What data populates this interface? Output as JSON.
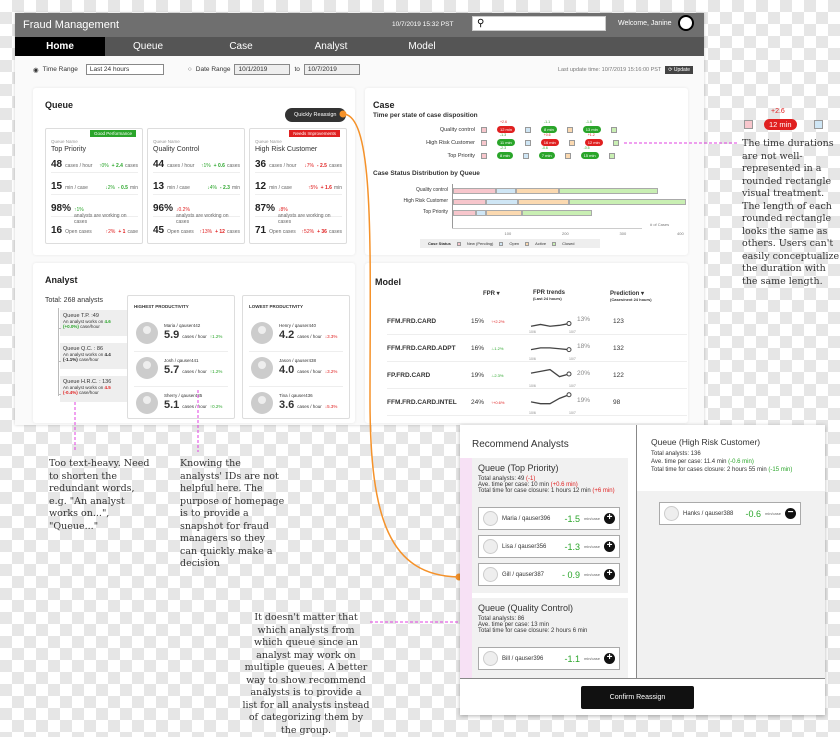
{
  "header": {
    "title": "Fraud Management",
    "datetime": "10/7/2019 15:32 PST",
    "search_placeholder": "",
    "welcome": "Welcome, Janine"
  },
  "nav": [
    {
      "label": "Home",
      "active": true
    },
    {
      "label": "Queue"
    },
    {
      "label": "Case"
    },
    {
      "label": "Analyst"
    },
    {
      "label": "Model"
    }
  ],
  "filters": {
    "time_range_label": "Time Range",
    "time_range_value": "Last 24 hours",
    "date_range_label": "Date Range",
    "date_from": "10/1/2019",
    "to_label": "to",
    "date_to": "10/7/2019",
    "last_update": "Last update time: 10/7/2019 15:16:00 PST",
    "update_button": "⟳ Update"
  },
  "queue": {
    "title": "Queue",
    "reassign_button": "Quickly Reassign",
    "name_label": "Queue Name",
    "cards": [
      {
        "name": "Top Priority",
        "badge": "Good Performance",
        "badge_color": "#2aa52a",
        "rows": [
          {
            "value": "48",
            "unit": "cases / hour",
            "pct": "↑0%",
            "delta": "+ 2.4",
            "dunit": "cases",
            "pc": "g",
            "dc": "g"
          },
          {
            "value": "15",
            "unit": "min / case",
            "pct": "↓2%",
            "delta": "- 0.5",
            "dunit": "min",
            "pc": "g",
            "dc": "g"
          },
          {
            "value": "98%",
            "unit": "analysts are working on cases",
            "pct": "↑1%",
            "delta": "",
            "dunit": "",
            "pc": "g",
            "dc": "g"
          },
          {
            "value": "16",
            "unit": "Open cases",
            "pct": "↑2%",
            "delta": "+ 1",
            "dunit": "case",
            "pc": "r",
            "dc": "r"
          }
        ]
      },
      {
        "name": "Quality Control",
        "badge": "",
        "rows": [
          {
            "value": "44",
            "unit": "cases / hour",
            "pct": "↑1%",
            "delta": "+ 0.6",
            "dunit": "cases",
            "pc": "g",
            "dc": "g"
          },
          {
            "value": "13",
            "unit": "min / case",
            "pct": "↓4%",
            "delta": "- 2.3",
            "dunit": "min",
            "pc": "g",
            "dc": "g"
          },
          {
            "value": "96%",
            "unit": "analysts are working on cases",
            "pct": "↓0.2%",
            "delta": "",
            "dunit": "",
            "pc": "r",
            "dc": "r"
          },
          {
            "value": "45",
            "unit": "Open cases",
            "pct": "↑13%",
            "delta": "+ 12",
            "dunit": "cases",
            "pc": "r",
            "dc": "r"
          }
        ]
      },
      {
        "name": "High Risk Customer",
        "badge": "Needs Improvements",
        "badge_color": "#e02020",
        "rows": [
          {
            "value": "36",
            "unit": "cases / hour",
            "pct": "↓7%",
            "delta": "- 2.5",
            "dunit": "cases",
            "pc": "r",
            "dc": "r"
          },
          {
            "value": "12",
            "unit": "min / case",
            "pct": "↑5%",
            "delta": "+ 1.6",
            "dunit": "min",
            "pc": "r",
            "dc": "r"
          },
          {
            "value": "87%",
            "unit": "analysts are working on cases",
            "pct": "↓8%",
            "delta": "",
            "dunit": "",
            "pc": "r",
            "dc": "r"
          },
          {
            "value": "71",
            "unit": "Open cases",
            "pct": "↑52%",
            "delta": "+ 36",
            "dunit": "cases",
            "pc": "r",
            "dc": "r"
          }
        ]
      }
    ]
  },
  "case": {
    "title": "Case",
    "subtitle1": "Time per state of case disposition",
    "subtitle2": "Case Status Distribution by Queue",
    "time_rows": [
      {
        "label": "Quality control",
        "pills": [
          {
            "text": "12 min",
            "delta": "+2.6",
            "color": "#e02020"
          },
          {
            "text": "8 min",
            "delta": "-1.1",
            "color": "#2aa52a"
          },
          {
            "text": "13 min",
            "delta": "-1.8",
            "color": "#2aa52a"
          }
        ]
      },
      {
        "label": "High Risk Customer",
        "pills": [
          {
            "text": "11 min",
            "delta": "-1.3",
            "color": "#2aa52a"
          },
          {
            "text": "16 min",
            "delta": "+0.6",
            "color": "#e02020"
          },
          {
            "text": "12 min",
            "delta": "+1.2",
            "color": "#e02020"
          }
        ]
      },
      {
        "label": "Top Priority",
        "pills": [
          {
            "text": "8 min",
            "delta": "-2.3",
            "color": "#2aa52a"
          },
          {
            "text": "7 min",
            "delta": "-0.6",
            "color": "#2aa52a"
          },
          {
            "text": "15 min",
            "delta": "-0.5",
            "color": "#2aa52a"
          }
        ]
      }
    ],
    "chart_data": {
      "type": "bar",
      "stacked": true,
      "orientation": "horizontal",
      "categories": [
        "Quality control",
        "High Risk Customer",
        "Top Priority"
      ],
      "series": [
        {
          "name": "New (Pending)",
          "color": "#f7c6cc",
          "values": [
            75,
            58,
            40
          ]
        },
        {
          "name": "Open",
          "color": "#cfe6f5",
          "values": [
            35,
            55,
            18
          ]
        },
        {
          "name": "Active",
          "color": "#fbd9b0",
          "values": [
            75,
            88,
            62
          ]
        },
        {
          "name": "Closed",
          "color": "#c9efb3",
          "values": [
            172,
            205,
            122
          ]
        }
      ],
      "xlabel": "# of Cases",
      "xticks": [
        100,
        200,
        300,
        400
      ],
      "xlim": [
        0,
        420
      ],
      "legend_title": "Case Status",
      "legend": "bottom"
    }
  },
  "analyst": {
    "title": "Analyst",
    "total": "Total: 268 analysts",
    "queues": [
      {
        "name": "Queue T.P. :49",
        "desc": "An analyst works on",
        "val": "4.6",
        "chg": "(+0.0%)",
        "unit": "case/hour",
        "c": "g"
      },
      {
        "name": "Queue Q.C. : 86",
        "desc": "An analyst works on",
        "val": "4.4",
        "chg": "(-1.1%)",
        "unit": "case/hour",
        "c": "k"
      },
      {
        "name": "Queue H.R.C. : 136",
        "desc": "An analyst works on",
        "val": "4.5",
        "chg": "(-0.4%)",
        "unit": "case/hour",
        "c": "r"
      }
    ],
    "highest": {
      "title": "HIGHEST PRODUCTIVITY",
      "items": [
        {
          "name": "Maria / qauser442",
          "value": "5.9",
          "unit": "cases / hour",
          "chg": "↑1.2%",
          "c": "g"
        },
        {
          "name": "Josh / qauser441",
          "value": "5.7",
          "unit": "cases / hour",
          "chg": "↑1.2%",
          "c": "g"
        },
        {
          "name": "Sherry / qauser435",
          "value": "5.1",
          "unit": "cases / hour",
          "chg": "↑0.2%",
          "c": "g"
        }
      ]
    },
    "lowest": {
      "title": "LOWEST PRODUCTIVITY",
      "items": [
        {
          "name": "Henry / qauser440",
          "value": "4.2",
          "unit": "cases / hour",
          "chg": "↓3.3%",
          "c": "r"
        },
        {
          "name": "Jason / qauser438",
          "value": "4.0",
          "unit": "cases / hour",
          "chg": "↓3.2%",
          "c": "r"
        },
        {
          "name": "Tina / qauser436",
          "value": "3.6",
          "unit": "cases / hour",
          "chg": "↓5.3%",
          "c": "r"
        }
      ]
    }
  },
  "model": {
    "title": "Model",
    "col_fpr": "FPR",
    "col_trend": "FPR trends",
    "col_trend_sub": "(Last 24 hours)",
    "col_pred": "Prediction",
    "col_pred_sub": "(Cases/next 24 hours)",
    "rows": [
      {
        "name": "FFM.FRD.CARD",
        "fpr": "15%",
        "chg": "↑+2.2%",
        "c": "r",
        "last": "13%",
        "pred": "123",
        "trend": [
          12,
          14,
          12,
          13,
          15
        ]
      },
      {
        "name": "FFM.FRD.CARD.ADPT",
        "fpr": "16%",
        "chg": "↓-1.2%",
        "c": "g",
        "last": "18%",
        "pred": "132",
        "trend": [
          16,
          18,
          18,
          17,
          16
        ]
      },
      {
        "name": "FP.FRD.CARD",
        "fpr": "19%",
        "chg": "↓-2.3%",
        "c": "g",
        "last": "20%",
        "pred": "122",
        "trend": [
          20,
          22,
          24,
          16,
          19
        ]
      },
      {
        "name": "FFM.FRD.CARD.INTEL",
        "fpr": "24%",
        "chg": "↑+0.6%",
        "c": "r",
        "last": "19%",
        "pred": "98",
        "trend": [
          18,
          16,
          16,
          22,
          26
        ]
      }
    ],
    "trend_axis": {
      "start": "10/6",
      "end": "10/7"
    }
  },
  "modal": {
    "title": "Recommend Analysts",
    "top": {
      "title": "Queue (Top Priority)",
      "l1": "Total analysts: 49",
      "l1d": "(-1)",
      "l2": "Ave. time per case: 10 min",
      "l2d": "(+0.6 min)",
      "l3": "Total time for case closure: 1 hours 12 min",
      "l3d": "(+6 min)",
      "items": [
        {
          "name": "Maria / qauser396",
          "delta": "-1.5"
        },
        {
          "name": "Lisa / qauser356",
          "delta": "-1.3"
        },
        {
          "name": "Gill / qauser387",
          "delta": "- 0.9"
        }
      ]
    },
    "qc": {
      "title": "Queue (Quality Control)",
      "l1": "Total analysts: 86",
      "l2": "Ave. time per case: 13 min",
      "l3": "Total time for case closure: 2 hours 6 min",
      "items": [
        {
          "name": "Bill / qauser396",
          "delta": "-1.1"
        }
      ]
    },
    "hrc": {
      "title": "Queue (High Risk Customer)",
      "l1": "Total analysts: 136",
      "l2": "Ave. time per case: 11.4 min",
      "l2d": "(-0.6 min)",
      "l3": "Total time for cases closure: 2 hours 55 min",
      "l3d": "(-15 min)",
      "items": [
        {
          "name": "Hanks / qauser388",
          "delta": "-0.6"
        }
      ]
    },
    "unit": "min/case",
    "confirm": "Confirm Reassign"
  },
  "annotations": {
    "right_delta": "+2.6",
    "right_pill": "12 min",
    "right": "The time durations are not well-represented in a rounded rectangle visual treatment. The length of each rounded rectangle looks the same as others. Users can't easily conceptualize the duration with the same length.",
    "a1": "Too text-heavy. Need to shorten the redundant words, e.g. \"An analyst works on...\", \"Queue...\"",
    "a2": "Knowing the analysts' IDs are not helpful here. The purpose of homepage is to provide a snapshot for fraud managers so they can quickly make a decision",
    "a3": "It doesn't matter that which analysts from which queue since an analyst may work on multiple queues. A better way to show recommend analysts is to provide a list for all analysts instead of categorizing them by the group."
  }
}
